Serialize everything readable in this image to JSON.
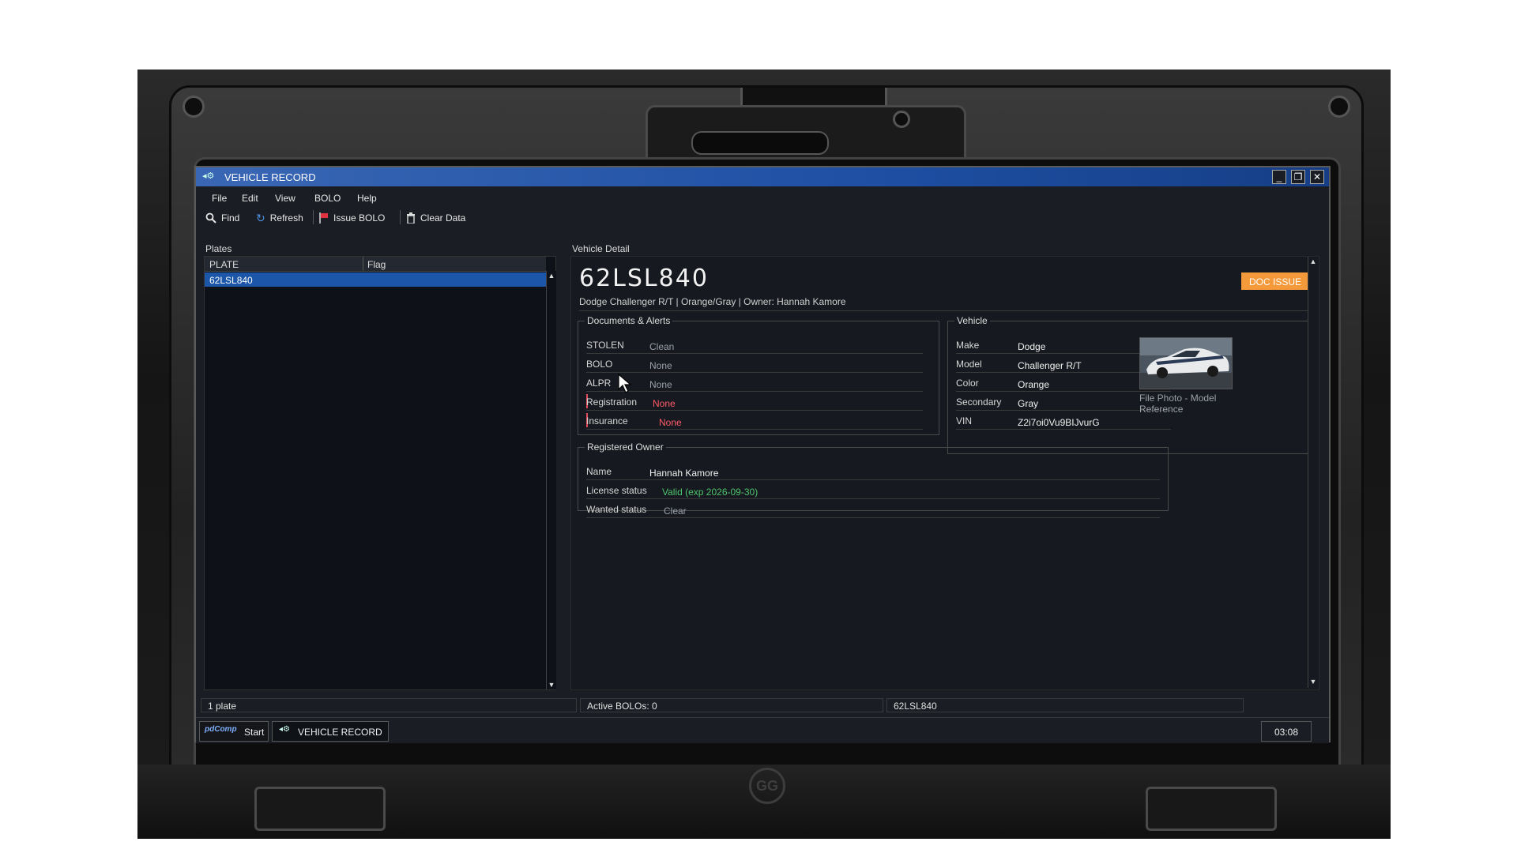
{
  "window": {
    "title": "VEHICLE RECORD",
    "minimize_glyph": "_",
    "restore_glyph": "❐",
    "close_glyph": "✕"
  },
  "menu": [
    "File",
    "Edit",
    "View",
    "BOLO",
    "Help"
  ],
  "toolbar": {
    "find": "Find",
    "refresh": "Refresh",
    "issue_bolo": "Issue BOLO",
    "clear_data": "Clear Data"
  },
  "plates": {
    "label": "Plates",
    "columns": [
      "PLATE",
      "Flag"
    ],
    "rows": [
      {
        "plate": "62LSL840",
        "flag": ""
      }
    ]
  },
  "detail": {
    "label": "Vehicle Detail",
    "plate": "62LSL840",
    "summary": "Dodge Challenger R/T | Orange/Gray | Owner: Hannah Kamore",
    "badge": "DOC ISSUE",
    "docs": {
      "title": "Documents & Alerts",
      "rows": [
        {
          "key": "STOLEN",
          "value": "Clean"
        },
        {
          "key": "BOLO",
          "value": "None"
        },
        {
          "key": "ALPR",
          "value": "None"
        },
        {
          "key": "Registration",
          "value": "None"
        },
        {
          "key": "Insurance",
          "value": "None"
        }
      ]
    },
    "vehicle": {
      "title": "Vehicle",
      "rows": [
        {
          "key": "Make",
          "value": "Dodge"
        },
        {
          "key": "Model",
          "value": "Challenger R/T"
        },
        {
          "key": "Color",
          "value": "Orange"
        },
        {
          "key": "Secondary",
          "value": "Gray"
        },
        {
          "key": "VIN",
          "value": "Z2i7oi0Vu9BIJvurG"
        }
      ],
      "photo_caption": "File Photo - Model Reference"
    },
    "owner": {
      "title": "Registered Owner",
      "rows": [
        {
          "key": "Name",
          "value": "Hannah Kamore"
        },
        {
          "key": "License status",
          "value": "Valid (exp 2026-09-30)"
        },
        {
          "key": "Wanted status",
          "value": "Clear"
        }
      ]
    }
  },
  "status": {
    "plates": "1 plate",
    "bolos": "Active BOLOs: 0",
    "selected": "62LSL840"
  },
  "taskbar": {
    "logo": "pdComp",
    "start": "Start",
    "task": "VEHICLE RECORD",
    "clock": "03:08"
  },
  "colors": {
    "titlebar": "#1e4fa3",
    "selection": "#1b56a8",
    "badge": "#f59a3a",
    "alert_red": "#ff5a6a",
    "valid_green": "#4ec36c"
  },
  "laptop_brand": "GG"
}
